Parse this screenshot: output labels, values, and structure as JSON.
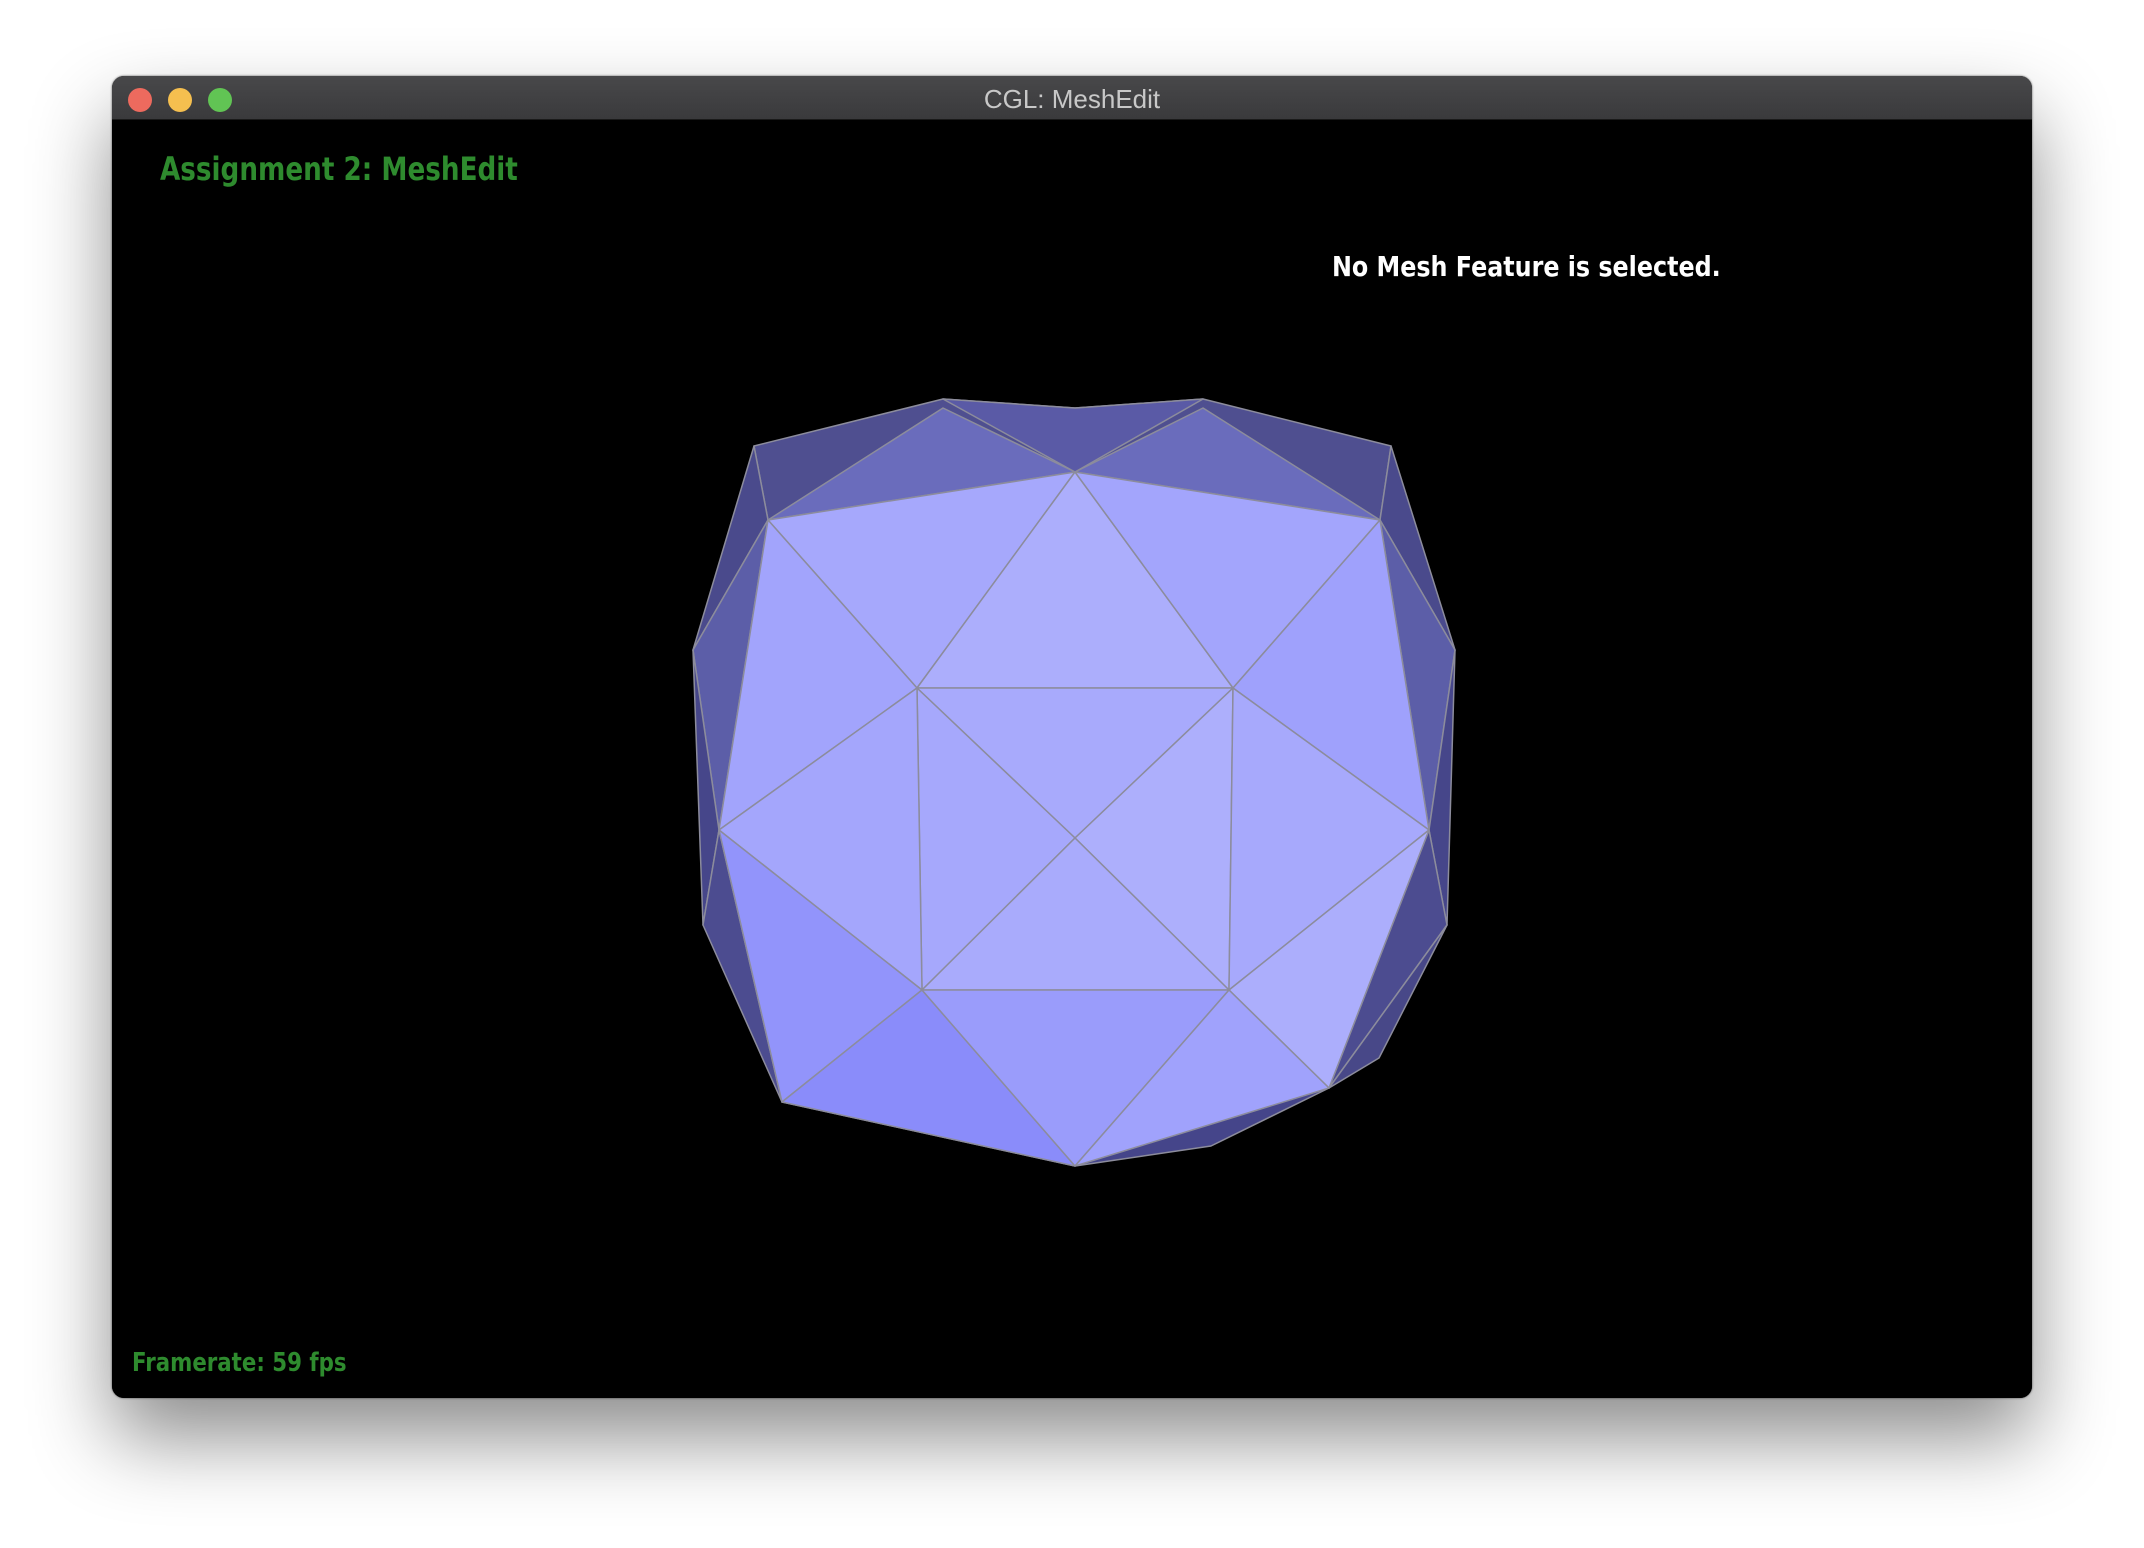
{
  "window": {
    "title": "CGL: MeshEdit"
  },
  "hud": {
    "assignment_title": "Assignment 2: MeshEdit",
    "selection_status": "No Mesh Feature is selected.",
    "framerate": "Framerate: 59 fps"
  },
  "colors": {
    "hud_green": "#2e8b2e",
    "mesh_face": "#a8aafc",
    "mesh_edge": "#8c8c9c",
    "background": "#000000"
  }
}
